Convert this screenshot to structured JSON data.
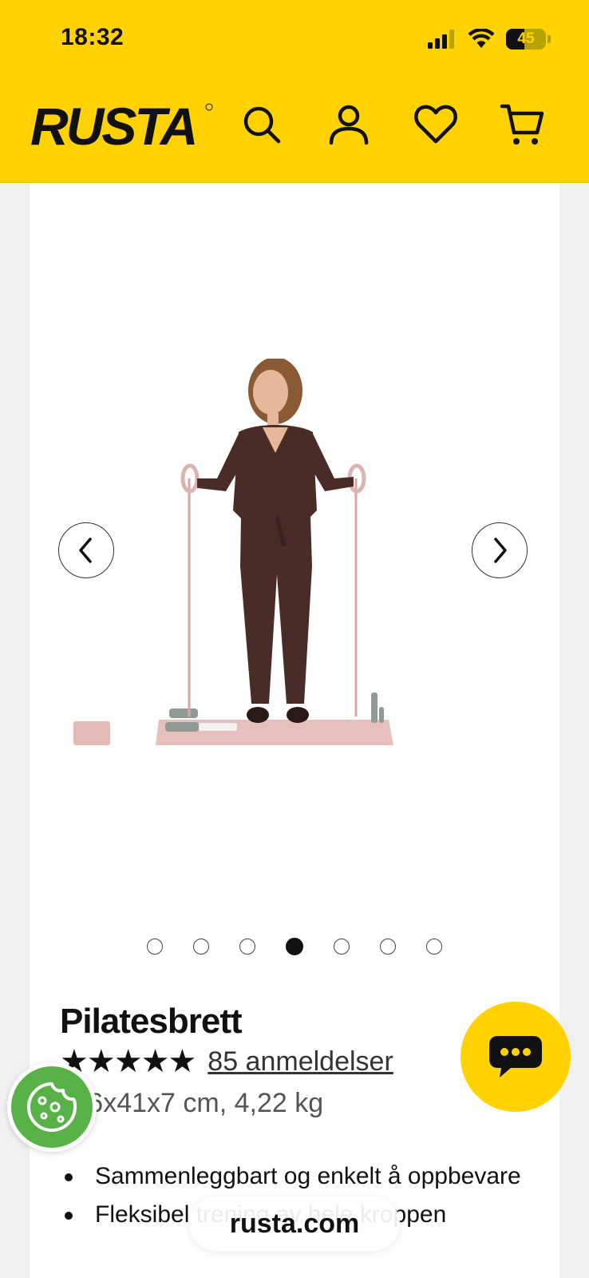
{
  "status_bar": {
    "time": "18:32",
    "battery": "45"
  },
  "header": {
    "logo": "RUSTA",
    "icons": [
      "search-icon",
      "account-icon",
      "wishlist-heart-icon",
      "cart-icon"
    ]
  },
  "gallery": {
    "dot_count": 7,
    "active_index": 3
  },
  "product": {
    "title": "Pilatesbrett",
    "stars": "★★★★★",
    "rating": 5,
    "reviews_link": "85 anmeldelser",
    "spec": "116x41x7 cm, 4,22 kg",
    "bullets": [
      "Sammenleggbart og enkelt å oppbevare",
      "Fleksibel trening av hele kroppen"
    ]
  },
  "browser": {
    "url": "rusta.com"
  },
  "colors": {
    "brand_yellow": "#ffd200",
    "cookie_green": "#58b248"
  }
}
